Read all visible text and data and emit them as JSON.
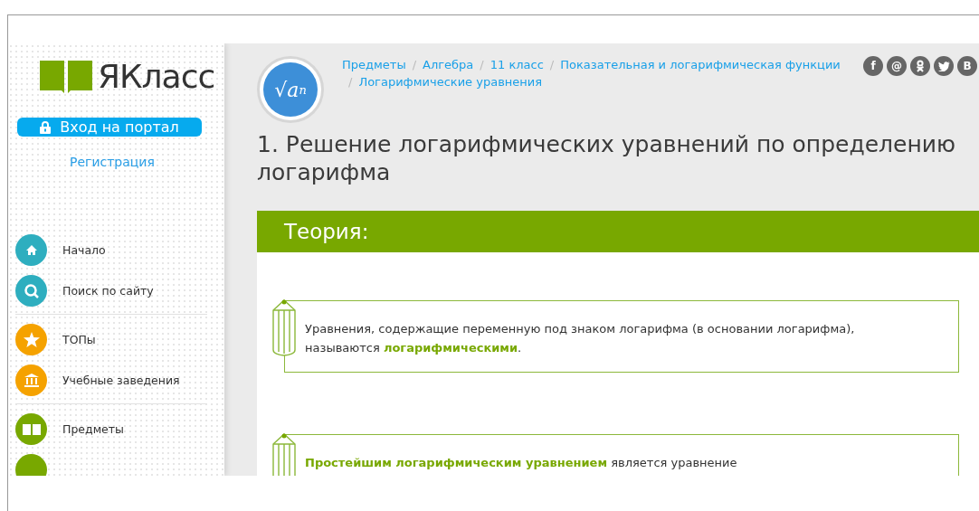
{
  "logo": {
    "text": "ЯКласс"
  },
  "login_button": {
    "label": "Вход на портал"
  },
  "register_link": "Регистрация",
  "nav_groups": [
    [
      {
        "label": "Начало",
        "kind": "home",
        "color": "#2eaebf"
      },
      {
        "label": "Поиск по сайту",
        "kind": "search",
        "color": "#2eaebf"
      }
    ],
    [
      {
        "label": "ТОПы",
        "kind": "star",
        "color": "#f5a200"
      },
      {
        "label": "Учебные заведения",
        "kind": "building",
        "color": "#f5a200"
      }
    ],
    [
      {
        "label": "Предметы",
        "kind": "book",
        "color": "#78a800"
      },
      {
        "kind": "partial",
        "color": "#78a800"
      }
    ]
  ],
  "subject_badge": {
    "text": "√a",
    "sup": "n"
  },
  "breadcrumb_separator": "/",
  "breadcrumbs": [
    "Предметы",
    "Алгебра",
    "11 класс",
    "Показательная и логарифмическая функции",
    "Логарифмические уравнения"
  ],
  "social": [
    {
      "kind": "facebook",
      "glyph": "f"
    },
    {
      "kind": "mail",
      "glyph": "@"
    },
    {
      "kind": "ok"
    },
    {
      "kind": "twitter"
    },
    {
      "kind": "vk",
      "glyph": "В"
    }
  ],
  "title": "1. Решение логарифмических уравнений по определению логарифма",
  "section": {
    "heading": "Теория:",
    "notes": [
      "Уравнения, содержащие переменную под знаком логарифма (в основании логарифма), называются **логарифмическими**.",
      "**Простейшим логарифмическим уравнением** является уравнение"
    ]
  }
}
